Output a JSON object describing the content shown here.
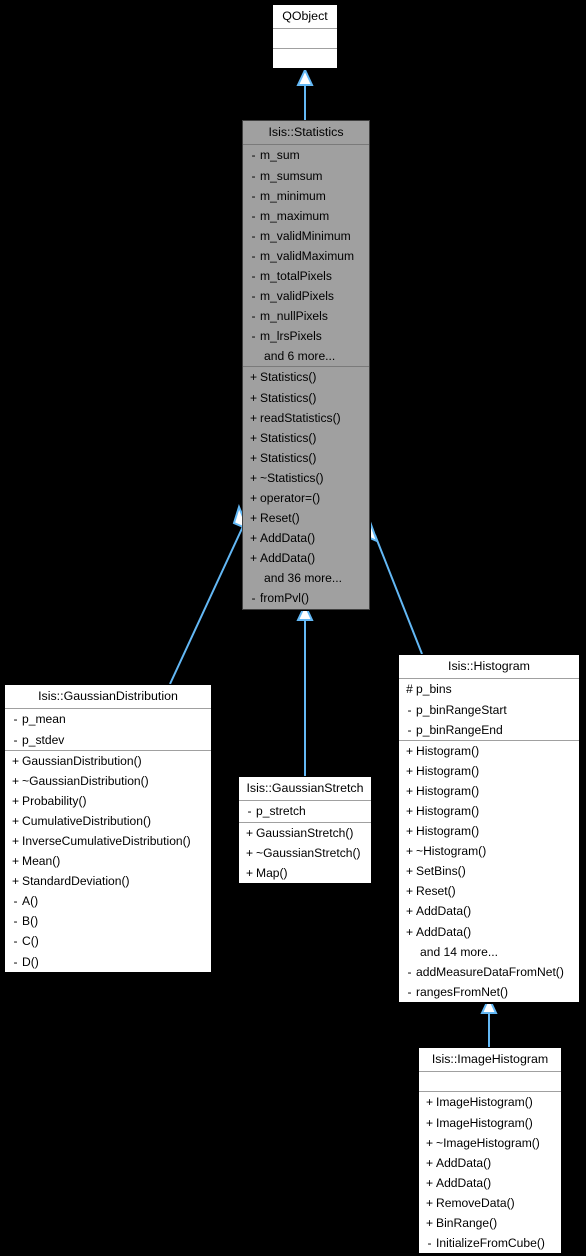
{
  "diagram": {
    "type": "uml-class-inheritance",
    "background_color": "#000000",
    "edge_color": "#63b8f5",
    "highlight_color": "#a0a0a0",
    "node_fill": "#ffffff",
    "classes": [
      {
        "id": "qobject",
        "name": "QObject",
        "highlighted": false,
        "attributes": [],
        "methods": []
      },
      {
        "id": "statistics",
        "name": "Isis::Statistics",
        "highlighted": true,
        "attributes": [
          {
            "vis": "-",
            "label": "m_sum"
          },
          {
            "vis": "-",
            "label": "m_sumsum"
          },
          {
            "vis": "-",
            "label": "m_minimum"
          },
          {
            "vis": "-",
            "label": "m_maximum"
          },
          {
            "vis": "-",
            "label": "m_validMinimum"
          },
          {
            "vis": "-",
            "label": "m_validMaximum"
          },
          {
            "vis": "-",
            "label": "m_totalPixels"
          },
          {
            "vis": "-",
            "label": "m_validPixels"
          },
          {
            "vis": "-",
            "label": "m_nullPixels"
          },
          {
            "vis": "-",
            "label": "m_lrsPixels"
          },
          {
            "vis": "",
            "label": "and 6 more..."
          }
        ],
        "methods": [
          {
            "vis": "+",
            "label": "Statistics()"
          },
          {
            "vis": "+",
            "label": "Statistics()"
          },
          {
            "vis": "+",
            "label": "readStatistics()"
          },
          {
            "vis": "+",
            "label": "Statistics()"
          },
          {
            "vis": "+",
            "label": "Statistics()"
          },
          {
            "vis": "+",
            "label": "~Statistics()"
          },
          {
            "vis": "+",
            "label": "operator=()"
          },
          {
            "vis": "+",
            "label": "Reset()"
          },
          {
            "vis": "+",
            "label": "AddData()"
          },
          {
            "vis": "+",
            "label": "AddData()"
          },
          {
            "vis": "",
            "label": "and 36 more..."
          },
          {
            "vis": "-",
            "label": "fromPvl()"
          }
        ]
      },
      {
        "id": "gaussiandistribution",
        "name": "Isis::GaussianDistribution",
        "highlighted": false,
        "attributes": [
          {
            "vis": "-",
            "label": "p_mean"
          },
          {
            "vis": "-",
            "label": "p_stdev"
          }
        ],
        "methods": [
          {
            "vis": "+",
            "label": "GaussianDistribution()"
          },
          {
            "vis": "+",
            "label": "~GaussianDistribution()"
          },
          {
            "vis": "+",
            "label": "Probability()"
          },
          {
            "vis": "+",
            "label": "CumulativeDistribution()"
          },
          {
            "vis": "+",
            "label": "InverseCumulativeDistribution()"
          },
          {
            "vis": "+",
            "label": "Mean()"
          },
          {
            "vis": "+",
            "label": "StandardDeviation()"
          },
          {
            "vis": "-",
            "label": "A()"
          },
          {
            "vis": "-",
            "label": "B()"
          },
          {
            "vis": "-",
            "label": "C()"
          },
          {
            "vis": "-",
            "label": "D()"
          }
        ]
      },
      {
        "id": "gaussianstretch",
        "name": "Isis::GaussianStretch",
        "highlighted": false,
        "attributes": [
          {
            "vis": "-",
            "label": "p_stretch"
          }
        ],
        "methods": [
          {
            "vis": "+",
            "label": "GaussianStretch()"
          },
          {
            "vis": "+",
            "label": "~GaussianStretch()"
          },
          {
            "vis": "+",
            "label": "Map()"
          }
        ]
      },
      {
        "id": "histogram",
        "name": "Isis::Histogram",
        "highlighted": false,
        "attributes": [
          {
            "vis": "#",
            "label": "p_bins"
          },
          {
            "vis": "-",
            "label": "p_binRangeStart"
          },
          {
            "vis": "-",
            "label": "p_binRangeEnd"
          }
        ],
        "methods": [
          {
            "vis": "+",
            "label": "Histogram()"
          },
          {
            "vis": "+",
            "label": "Histogram()"
          },
          {
            "vis": "+",
            "label": "Histogram()"
          },
          {
            "vis": "+",
            "label": "Histogram()"
          },
          {
            "vis": "+",
            "label": "Histogram()"
          },
          {
            "vis": "+",
            "label": "~Histogram()"
          },
          {
            "vis": "+",
            "label": "SetBins()"
          },
          {
            "vis": "+",
            "label": "Reset()"
          },
          {
            "vis": "+",
            "label": "AddData()"
          },
          {
            "vis": "+",
            "label": "AddData()"
          },
          {
            "vis": "",
            "label": "and 14 more..."
          },
          {
            "vis": "-",
            "label": "addMeasureDataFromNet()"
          },
          {
            "vis": "-",
            "label": "rangesFromNet()"
          }
        ]
      },
      {
        "id": "imagehistogram",
        "name": "Isis::ImageHistogram",
        "highlighted": false,
        "attributes": [],
        "methods": [
          {
            "vis": "+",
            "label": "ImageHistogram()"
          },
          {
            "vis": "+",
            "label": "ImageHistogram()"
          },
          {
            "vis": "+",
            "label": "~ImageHistogram()"
          },
          {
            "vis": "+",
            "label": "AddData()"
          },
          {
            "vis": "+",
            "label": "AddData()"
          },
          {
            "vis": "+",
            "label": "RemoveData()"
          },
          {
            "vis": "+",
            "label": "BinRange()"
          },
          {
            "vis": "-",
            "label": "InitializeFromCube()"
          }
        ]
      }
    ],
    "edges": [
      {
        "from": "statistics",
        "to": "qobject",
        "kind": "inheritance"
      },
      {
        "from": "gaussiandistribution",
        "to": "statistics",
        "kind": "inheritance"
      },
      {
        "from": "gaussianstretch",
        "to": "statistics",
        "kind": "inheritance"
      },
      {
        "from": "histogram",
        "to": "statistics",
        "kind": "inheritance"
      },
      {
        "from": "imagehistogram",
        "to": "histogram",
        "kind": "inheritance"
      }
    ]
  }
}
